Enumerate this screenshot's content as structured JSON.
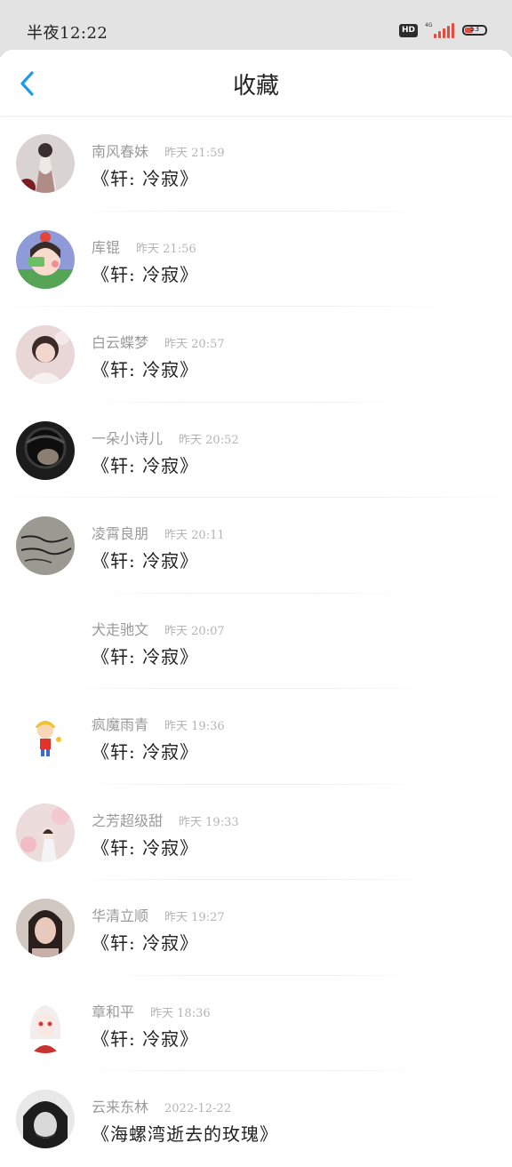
{
  "status_bar": {
    "time": "半夜12:22",
    "hd_label": "HD",
    "network_label": "4G",
    "battery_level": "53",
    "battery_color": "#e64b3c"
  },
  "header": {
    "title": "收藏",
    "back_icon": "chevron-left-icon",
    "accent_color": "#1f9be6"
  },
  "favorites": [
    {
      "author": "南风春妹",
      "time": "昨天 21:59",
      "title": "《轩: 冷寂》"
    },
    {
      "author": "库锟",
      "time": "昨天 21:56",
      "title": "《轩: 冷寂》"
    },
    {
      "author": "白云蝶梦",
      "time": "昨天 20:57",
      "title": "《轩: 冷寂》"
    },
    {
      "author": "一朵小诗儿",
      "time": "昨天 20:52",
      "title": "《轩: 冷寂》"
    },
    {
      "author": "凌霄良朋",
      "time": "昨天 20:11",
      "title": "《轩: 冷寂》"
    },
    {
      "author": "犬走驰文",
      "time": "昨天 20:07",
      "title": "《轩: 冷寂》"
    },
    {
      "author": "疯魔雨青",
      "time": "昨天 19:36",
      "title": "《轩: 冷寂》"
    },
    {
      "author": "之芳超级甜",
      "time": "昨天 19:33",
      "title": "《轩: 冷寂》"
    },
    {
      "author": "华清立顺",
      "time": "昨天 19:27",
      "title": "《轩: 冷寂》"
    },
    {
      "author": "章和平",
      "time": "昨天 18:36",
      "title": "《轩: 冷寂》"
    },
    {
      "author": "云来东林",
      "time": "2022-12-22",
      "title": "《海螺湾逝去的玫瑰》"
    }
  ]
}
